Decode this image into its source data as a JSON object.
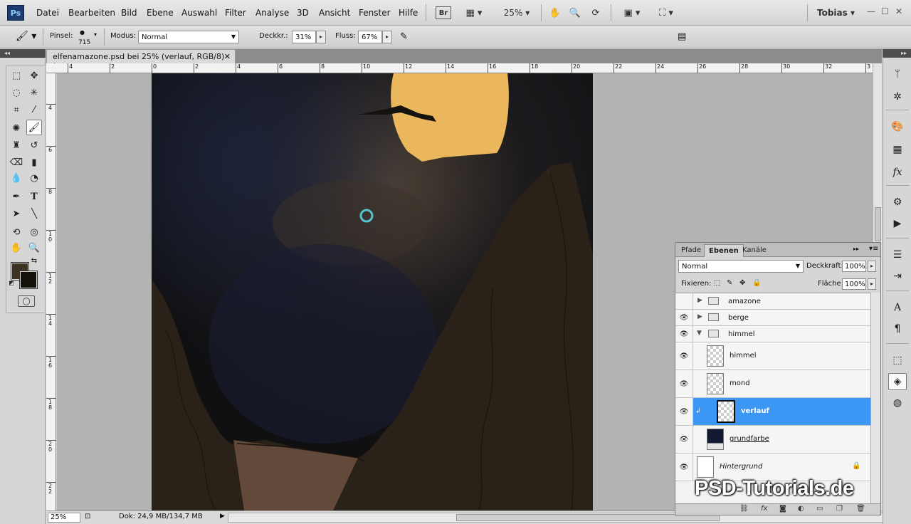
{
  "app": {
    "logo": "Ps",
    "user": "Tobias"
  },
  "menu": [
    "Datei",
    "Bearbeiten",
    "Bild",
    "Ebene",
    "Auswahl",
    "Filter",
    "Analyse",
    "3D",
    "Ansicht",
    "Fenster",
    "Hilfe"
  ],
  "menubar": {
    "zoom": "25%",
    "bridge_label": "Br"
  },
  "options": {
    "brush_label": "Pinsel:",
    "brush_size": "715",
    "mode_label": "Modus:",
    "mode_value": "Normal",
    "opacity_label": "Deckkr.:",
    "opacity_value": "31%",
    "flow_label": "Fluss:",
    "flow_value": "67%"
  },
  "document": {
    "tab_title": "elfenamazone.psd bei 25% (verlauf, RGB/8) *",
    "zoom": "25%",
    "info": "Dok: 24,9 MB/134,7 MB",
    "ruler_top": [
      "4",
      "2",
      "0",
      "2",
      "4",
      "6",
      "8",
      "10",
      "12",
      "14",
      "16",
      "18",
      "20",
      "22",
      "24",
      "26",
      "28",
      "30",
      "32",
      "3"
    ],
    "ruler_left": [
      "2",
      "4",
      "6",
      "8",
      "10",
      "12",
      "14",
      "16",
      "18",
      "20",
      "22"
    ]
  },
  "layers_panel": {
    "tabs": [
      "Pfade",
      "Ebenen",
      "Kanäle"
    ],
    "active_tab": "Ebenen",
    "blend_mode": "Normal",
    "opacity_label": "Deckkraft:",
    "opacity_value": "100%",
    "lock_label": "Fixieren:",
    "fill_label": "Fläche:",
    "fill_value": "100%",
    "layers": [
      {
        "name": "amazone",
        "type": "group",
        "visible": false,
        "expanded": false
      },
      {
        "name": "berge",
        "type": "group",
        "visible": true,
        "expanded": false
      },
      {
        "name": "himmel",
        "type": "group",
        "visible": true,
        "expanded": true
      },
      {
        "name": "himmel",
        "type": "layer",
        "visible": true
      },
      {
        "name": "mond",
        "type": "layer",
        "visible": true
      },
      {
        "name": "verlauf",
        "type": "layer",
        "visible": true,
        "selected": true
      },
      {
        "name": "grundfarbe",
        "type": "layer",
        "visible": true
      },
      {
        "name": "Hintergrund",
        "type": "background",
        "visible": true,
        "locked": true
      }
    ]
  },
  "watermark": "PSD-Tutorials.de",
  "colors": {
    "foreground": "#3c3323",
    "background": "#14110b",
    "selection": "#3b97f3",
    "moon": "#ebb75c"
  }
}
